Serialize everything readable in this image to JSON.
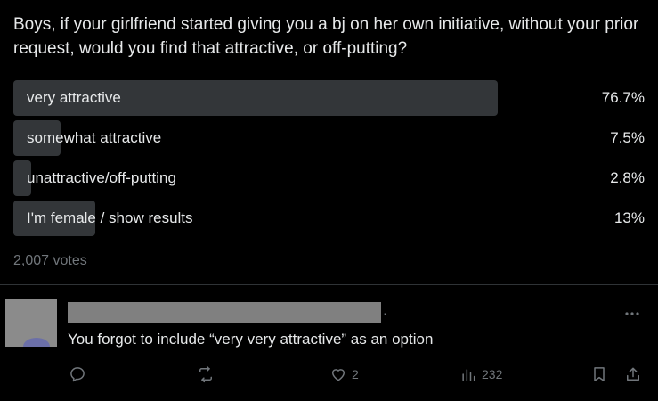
{
  "poll": {
    "question": "Boys, if your girlfriend started giving you a bj on her own initiative, without your prior request, would you find that attractive, or off-putting?",
    "options": [
      {
        "label": "very attractive",
        "percent": "76.7%",
        "fill": 0.767
      },
      {
        "label": "somewhat attractive",
        "percent": "7.5%",
        "fill": 0.075
      },
      {
        "label": "unattractive/off-putting",
        "percent": "2.8%",
        "fill": 0.028
      },
      {
        "label": "I'm female / show results",
        "percent": "13%",
        "fill": 0.13
      }
    ],
    "votes": "2,007 votes"
  },
  "reply": {
    "text": "You forgot to include “very very attractive” as an option",
    "name_separator": "·",
    "actions": {
      "reply_icon": "reply-icon",
      "repost_icon": "repost-icon",
      "like_icon": "heart-icon",
      "like_count": "2",
      "views_icon": "views-icon",
      "views_count": "232",
      "bookmark_icon": "bookmark-icon",
      "share_icon": "share-icon"
    }
  },
  "colors": {
    "background": "#000000",
    "bar": "#333639",
    "text": "#e7e9ea",
    "muted": "#71767b"
  }
}
